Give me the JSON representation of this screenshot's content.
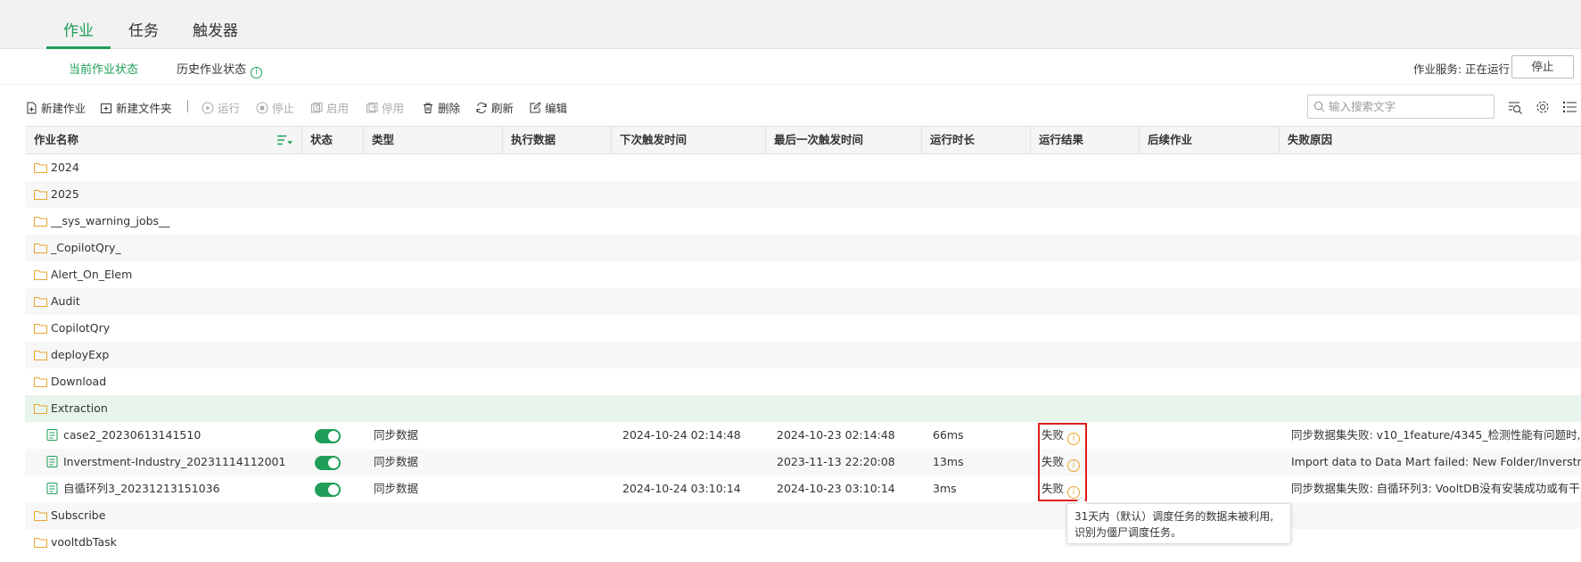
{
  "top_tabs": [
    "作业",
    "任务",
    "触发器"
  ],
  "sub_tabs": {
    "current": "当前作业状态",
    "history": "历史作业状态"
  },
  "service": {
    "status": "作业服务: 正在运行",
    "stop_label": "停止"
  },
  "toolbar": {
    "new_job": "新建作业",
    "new_folder": "新建文件夹",
    "run": "运行",
    "stop": "停止",
    "enable": "启用",
    "disable": "停用",
    "delete": "删除",
    "refresh": "刷新",
    "edit": "编辑",
    "search_placeholder": "输入搜索文字"
  },
  "columns": [
    "作业名称",
    "状态",
    "类型",
    "执行数据",
    "下次触发时间",
    "最后一次触发时间",
    "运行时长",
    "运行结果",
    "后续作业",
    "失败原因"
  ],
  "folders_top": [
    "2024",
    "2025",
    "__sys_warning_jobs__",
    "_CopilotQry_",
    "Alert_On_Elem",
    "Audit",
    "CopilotQry",
    "deployExp",
    "Download",
    "Extraction"
  ],
  "jobs": [
    {
      "name": "case2_20230613141510",
      "type": "同步数据",
      "next": "2024-10-24 02:14:48",
      "last": "2024-10-23 02:14:48",
      "duration": "66ms",
      "result": "失败",
      "reason": "同步数据集失败:    v10_1feature/4345_检测性能有问题时,"
    },
    {
      "name": "Inverstment-Industry_20231114112001",
      "type": "同步数据",
      "next": "",
      "last": "2023-11-13 22:20:08",
      "duration": "13ms",
      "result": "失败",
      "reason": "Import data to Data Mart failed:    New Folder/Inverstment-"
    },
    {
      "name": "自循环列3_20231213151036",
      "type": "同步数据",
      "next": "2024-10-24 03:10:14",
      "last": "2024-10-23 03:10:14",
      "duration": "3ms",
      "result": "失败",
      "reason": "同步数据集失败:    自循环列3: VooltDB没有安装成功或有干"
    }
  ],
  "folders_bottom": [
    "Subscribe",
    "vooltdbTask"
  ],
  "tooltip": {
    "line1": "31天内（默认）调度任务的数据未被利用,",
    "line2": "识别为僵尸调度任务。"
  },
  "colors": {
    "accent": "#1e9e58",
    "folder": "#e8a530",
    "highlight": "#e01b1b"
  }
}
